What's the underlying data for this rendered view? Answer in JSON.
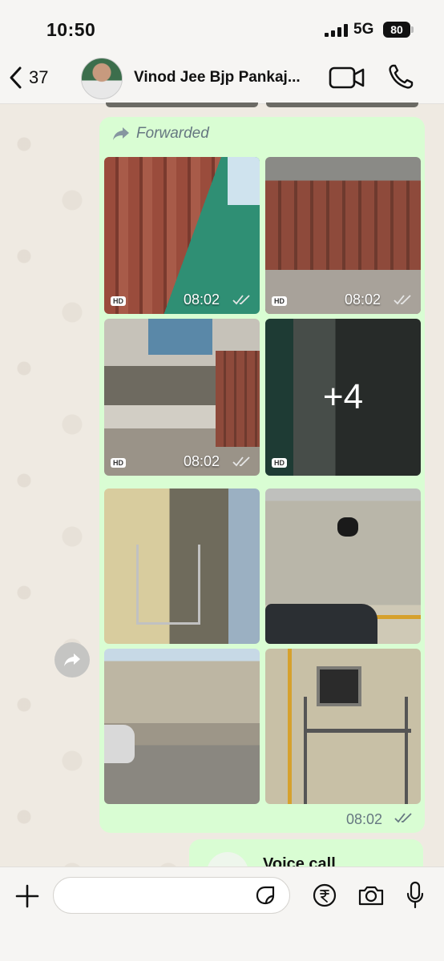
{
  "status_bar": {
    "time": "10:50",
    "network": "5G",
    "battery": "80"
  },
  "header": {
    "back_count": "37",
    "contact_name": "Vinod Jee Bjp Pankaj..."
  },
  "message": {
    "forwarded_label": "Forwarded",
    "photos": [
      {
        "time": "08:02",
        "hd": "HD"
      },
      {
        "time": "08:02",
        "hd": "HD"
      },
      {
        "time": "08:02",
        "hd": "HD"
      },
      {
        "hd": "HD",
        "more": "+4"
      }
    ],
    "time": "08:02"
  },
  "next_message": {
    "label": "Voice call"
  },
  "input": {
    "placeholder": ""
  },
  "colors": {
    "bubble": "#d9fdd3",
    "accent_tick": "#53bdeb",
    "header_bg": "#f6f5f3"
  }
}
